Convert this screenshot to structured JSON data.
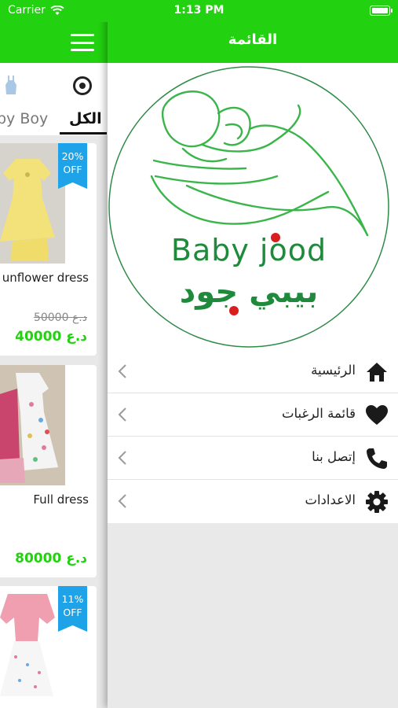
{
  "status_bar": {
    "carrier": "Carrier",
    "time": "1:13 PM"
  },
  "main": {
    "tabs": [
      {
        "label": "الكل",
        "icon": "target-icon"
      },
      {
        "label": "by Boy",
        "icon": "romper-icon"
      }
    ],
    "products": [
      {
        "name": "unflower dress",
        "old_price": "50000 د.ع",
        "price": "40000 د.ع",
        "badge_line1": "20%",
        "badge_line2": "OFF"
      },
      {
        "name": "Full dress",
        "old_price": "",
        "price": "80000 د.ع",
        "badge_line1": "",
        "badge_line2": ""
      },
      {
        "name": "",
        "old_price": "",
        "price": "",
        "badge_line1": "11%",
        "badge_line2": "OFF"
      }
    ]
  },
  "drawer": {
    "title": "القائمة",
    "logo": {
      "text_en": "Baby jood",
      "text_ar": "بيبي جود"
    },
    "menu": [
      {
        "label": "الرئيسية",
        "icon": "home-icon"
      },
      {
        "label": "قائمة الرغبات",
        "icon": "heart-icon"
      },
      {
        "label": "إتصل بنا",
        "icon": "phone-icon"
      },
      {
        "label": "الاعدادات",
        "icon": "gear-icon"
      }
    ]
  },
  "colors": {
    "brand_green": "#22d10f",
    "badge_blue": "#1fa3e8",
    "logo_green": "#1f8a3c"
  }
}
